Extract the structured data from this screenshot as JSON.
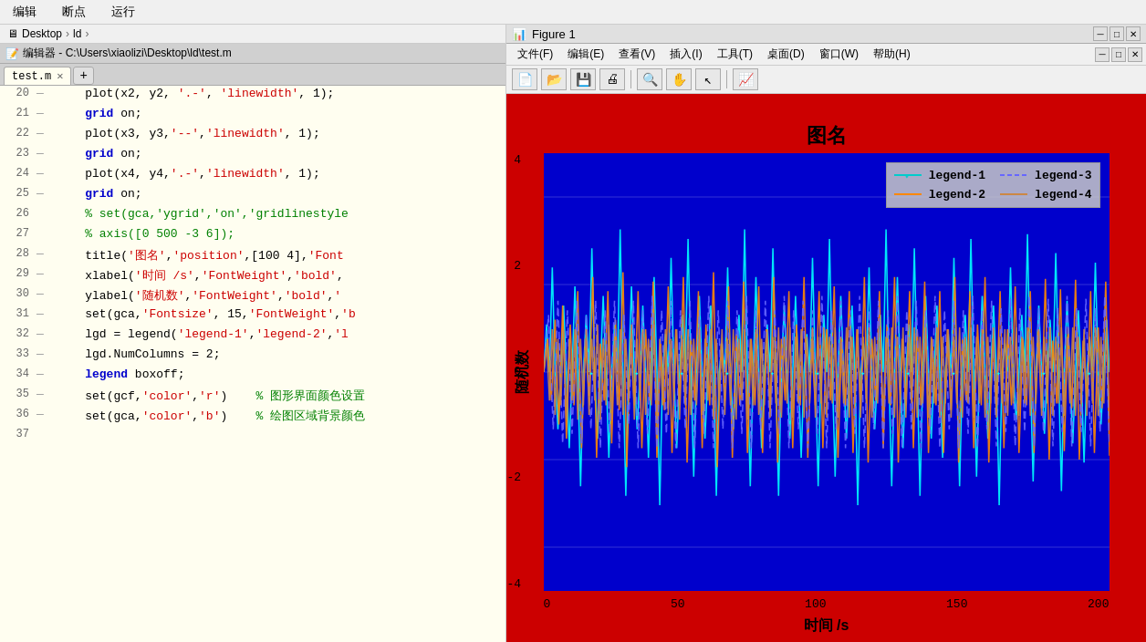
{
  "editor": {
    "menu": [
      "编辑",
      "断点",
      "运行"
    ],
    "breadcrumb": [
      "Desktop",
      "ld"
    ],
    "title": "编辑器 - C:\\Users\\xiaolizi\\Desktop\\ld\\test.m",
    "tab_name": "test.m",
    "lines": [
      {
        "num": 20,
        "dash": "—",
        "code": "    plot(x2, y2, '.−', 'linewidth', 1);",
        "type": "normal"
      },
      {
        "num": 21,
        "dash": "—",
        "code": "    grid on;",
        "type": "normal"
      },
      {
        "num": 22,
        "dash": "—",
        "code": "    plot(x3, y3,'−−','linewidth', 1);",
        "type": "normal"
      },
      {
        "num": 23,
        "dash": "—",
        "code": "    grid on;",
        "type": "normal"
      },
      {
        "num": 24,
        "dash": "—",
        "code": "    plot(x4, y4,'.−','linewidth', 1);",
        "type": "normal"
      },
      {
        "num": 25,
        "dash": "—",
        "code": "    grid on;",
        "type": "normal"
      },
      {
        "num": 26,
        "dash": "",
        "code": "% set(gca,'ygrid','on','gridlinestyle",
        "type": "comment"
      },
      {
        "num": 27,
        "dash": "",
        "code": "% axis([0 500 −3 6]);",
        "type": "comment"
      },
      {
        "num": 28,
        "dash": "—",
        "code": "    title('图名','position',[100 4],'Font",
        "type": "mixed"
      },
      {
        "num": 29,
        "dash": "—",
        "code": "    xlabel('时间 /s','FontWeight','bold',",
        "type": "mixed"
      },
      {
        "num": 30,
        "dash": "—",
        "code": "    ylabel('随机数','FontWeight','bold','",
        "type": "mixed"
      },
      {
        "num": 31,
        "dash": "—",
        "code": "    set(gca,'Fontsize', 15,'FontWeight','b",
        "type": "mixed"
      },
      {
        "num": 32,
        "dash": "—",
        "code": "    lgd = legend('legend-1','legend-2','l",
        "type": "mixed"
      },
      {
        "num": 33,
        "dash": "—",
        "code": "    lgd.NumColumns = 2;",
        "type": "normal"
      },
      {
        "num": 34,
        "dash": "—",
        "code": "    legend boxoff;",
        "type": "normal"
      },
      {
        "num": 35,
        "dash": "—",
        "code": "    set(gcf,'color','r')    % 图形界面颜色设置",
        "type": "mixed_comment"
      },
      {
        "num": 36,
        "dash": "—",
        "code": "    set(gca,'color','b')    % 绘图区域背景颜色",
        "type": "mixed_comment"
      },
      {
        "num": 37,
        "dash": "",
        "code": "",
        "type": "normal"
      }
    ]
  },
  "figure": {
    "title": "Figure 1",
    "menu": [
      "文件(F)",
      "编辑(E)",
      "查看(V)",
      "插入(I)",
      "工具(T)",
      "桌面(D)",
      "窗口(W)",
      "帮助(H)"
    ],
    "chart": {
      "title": "图名",
      "ylabel": "随机数",
      "xlabel": "时间 /s",
      "y_ticks": [
        "4",
        "2",
        "0",
        "-2",
        "-4"
      ],
      "x_ticks": [
        "0",
        "50",
        "100",
        "150",
        "200"
      ],
      "legend": [
        {
          "label": "legend-1",
          "color": "#00ffff",
          "style": "star-line"
        },
        {
          "label": "legend-2",
          "color": "#ff8800",
          "style": "solid"
        },
        {
          "label": "legend-3",
          "color": "#4444ff",
          "style": "dashed"
        },
        {
          "label": "legend-4",
          "color": "#cc8844",
          "style": "solid"
        }
      ]
    }
  }
}
